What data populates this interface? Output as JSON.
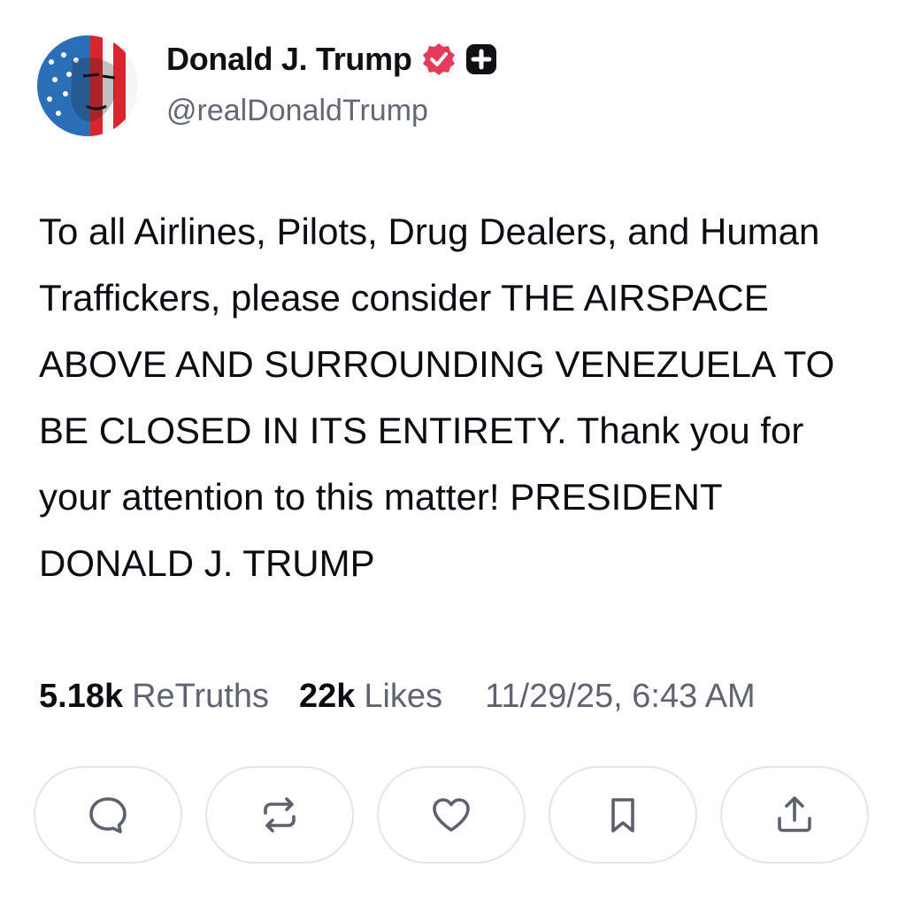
{
  "profile": {
    "display_name": "Donald J. Trump",
    "handle": "@realDonaldTrump",
    "verified_icon": "verified-badge-icon",
    "verified_color": "#e63a5a",
    "plus_icon": "plus-badge-icon"
  },
  "post": {
    "text": "To all Airlines, Pilots, Drug Dealers, and Human Traffickers, please consider THE AIRSPACE ABOVE AND SURROUNDING VENEZUELA TO BE CLOSED IN ITS ENTIRETY. Thank you for your attention to this matter! PRESIDENT DONALD J. TRUMP"
  },
  "stats": {
    "retruths_count": "5.18k",
    "retruths_label": "ReTruths",
    "likes_count": "22k",
    "likes_label": "Likes",
    "timestamp": "11/29/25, 6:43 AM"
  },
  "actions": [
    {
      "icon": "comment-icon"
    },
    {
      "icon": "retruth-icon"
    },
    {
      "icon": "heart-icon"
    },
    {
      "icon": "bookmark-icon"
    },
    {
      "icon": "share-icon"
    }
  ]
}
